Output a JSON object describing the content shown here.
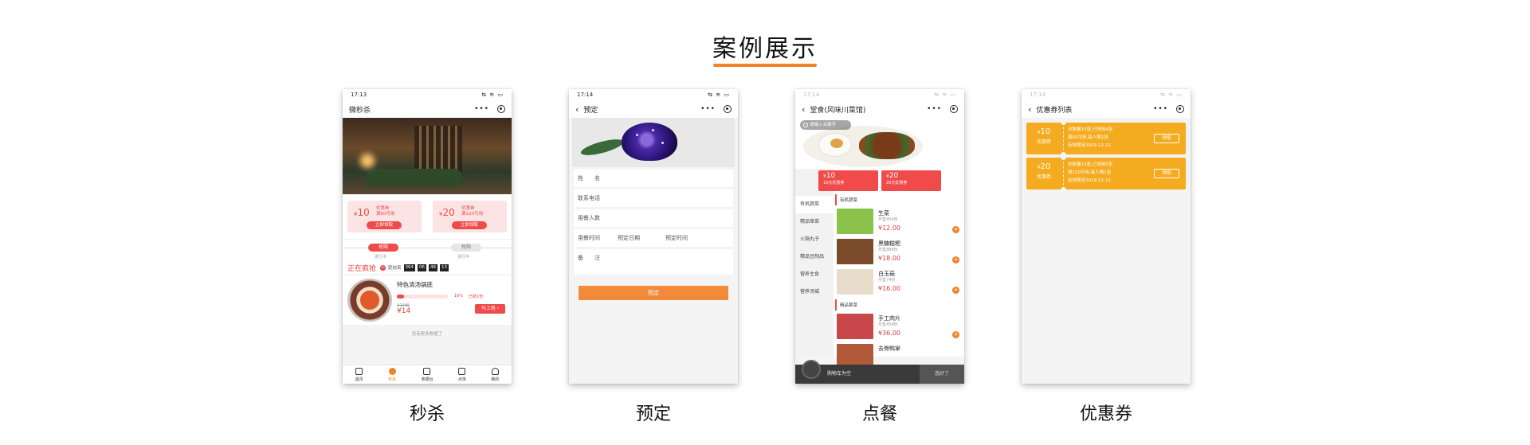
{
  "heading": {
    "title": "案例展示",
    "accent": "#f08228"
  },
  "phones": {
    "seckill": {
      "caption": "秒杀",
      "time": "17:13",
      "title": "微秒杀",
      "coupons": [
        {
          "amount": "10",
          "title": "优惠券",
          "rule": "满60可用",
          "button": "立即领取"
        },
        {
          "amount": "20",
          "title": "优惠券",
          "rule": "满120可用",
          "button": "立即领取"
        }
      ],
      "tab_active": "抢购",
      "tab_active_sub": "进行中",
      "tab_inactive": "抢购",
      "tab_inactive_sub": "进行中",
      "live_label": "正在疯抢",
      "countdown_label": "距结束",
      "countdown": [
        "364",
        "06",
        "46",
        "13"
      ],
      "deal": {
        "name": "特色清汤锅底",
        "progress_pct": "10%",
        "progress": 0.1,
        "sold": "已抢1份",
        "original_price": "¥16份",
        "price": "¥14",
        "buy": "马上抢"
      },
      "no_more": "没有更多数据了",
      "tabs": [
        "首页",
        "秒杀",
        "收银台",
        "点单",
        "我的"
      ]
    },
    "reserve": {
      "caption": "预定",
      "time": "17:14",
      "title": "预定",
      "fields": {
        "name": "姓　　名",
        "phone": "联系电话",
        "people": "用餐人数",
        "time_label": "用餐时间",
        "date_value": "预定日期",
        "time_value": "预定时间",
        "memo": "备　　注"
      },
      "submit": "预定"
    },
    "order": {
      "caption": "点餐",
      "time": "17:14",
      "title": "堂食(风味川菜馆)",
      "search_placeholder": "请输入关键字",
      "coupons": [
        {
          "amount": "10",
          "desc": "10元优惠券"
        },
        {
          "amount": "20",
          "desc": "20元优惠券"
        }
      ],
      "categories": [
        "有机蔬菜",
        "精品荤菜",
        "火锅丸子",
        "精品豆制品",
        "营养主食",
        "营养汤城"
      ],
      "section1": "有机蔬菜",
      "section2": "精品荤菜",
      "dishes": [
        {
          "name": "生菜",
          "sales": "月售954份",
          "price": "¥12.00",
          "color": "#8bc34a"
        },
        {
          "name": "黑糖糍粑",
          "sales": "月售889份",
          "price": "¥18.00",
          "color": "#7a4a2a"
        },
        {
          "name": "白玉菇",
          "sales": "月售74份",
          "price": "¥16.00",
          "color": "#e8dccb"
        },
        {
          "name": "手工肉片",
          "sales": "月售454份",
          "price": "¥36.00",
          "color": "#c8474a"
        },
        {
          "name": "去骨鸭掌",
          "sales": "",
          "price": "",
          "color": "#b05a3a"
        }
      ],
      "cart_empty": "购物车为空",
      "checkout": "选好了"
    },
    "coupons": {
      "caption": "优惠券",
      "time": "17:14",
      "title": "优惠券列表",
      "items": [
        {
          "amount": "10",
          "kind": "优惠券",
          "line1": "总数量10张,已领用4张",
          "line2": "满60可用,每人限1张",
          "line3": "有效期至2019-12-21",
          "button": "领取"
        },
        {
          "amount": "20",
          "kind": "优惠券",
          "line1": "总数量10张,已领用5张",
          "line2": "满120可用,每人限1张",
          "line3": "有效期至2019-12-21",
          "button": "领取"
        }
      ],
      "coupon_color": "#f5ab1f"
    }
  }
}
